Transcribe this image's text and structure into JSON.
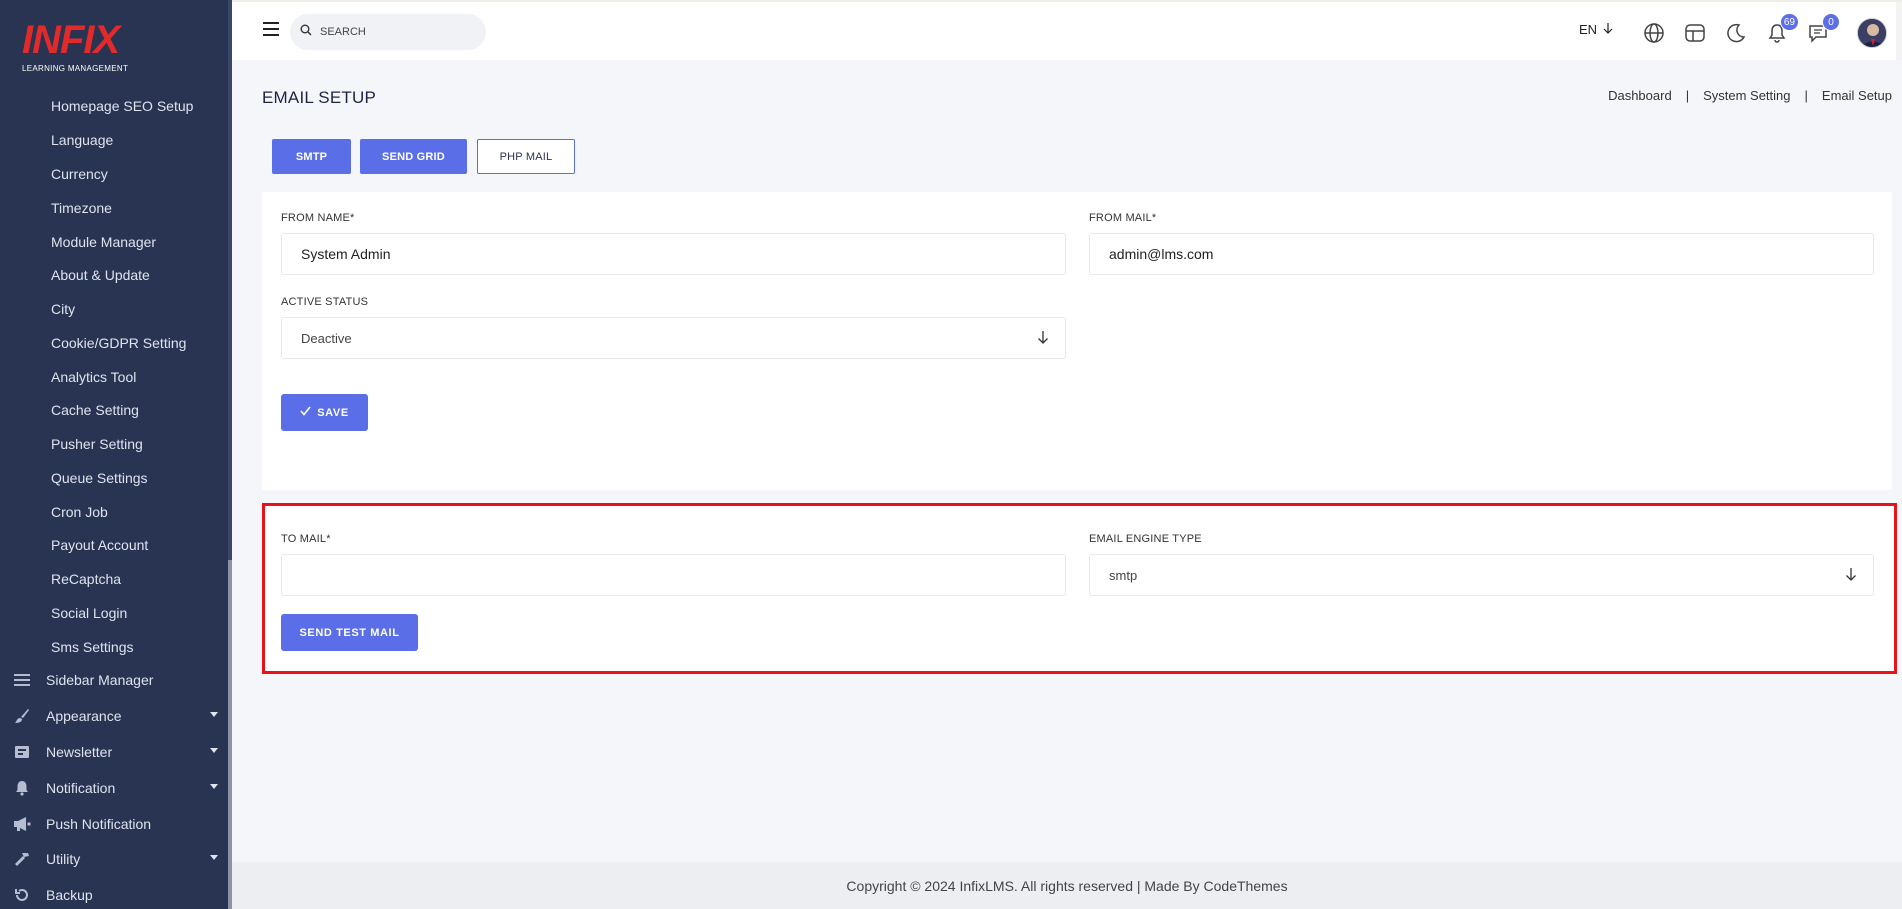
{
  "brand": {
    "name": "INFIX",
    "tagline": "LEARNING MANAGEMENT"
  },
  "sidebar": {
    "sub_items": [
      "Homepage SEO Setup",
      "Language",
      "Currency",
      "Timezone",
      "Module Manager",
      "About & Update",
      "City",
      "Cookie/GDPR Setting",
      "Analytics Tool",
      "Cache Setting",
      "Pusher Setting",
      "Queue Settings",
      "Cron Job",
      "Payout Account",
      "ReCaptcha",
      "Social Login",
      "Sms Settings"
    ],
    "main_items": [
      {
        "label": "Sidebar Manager",
        "icon": "list-icon"
      },
      {
        "label": "Appearance",
        "icon": "brush-icon"
      },
      {
        "label": "Newsletter",
        "icon": "newsletter-icon"
      },
      {
        "label": "Notification",
        "icon": "bell-icon"
      },
      {
        "label": "Push Notification",
        "icon": "megaphone-icon"
      },
      {
        "label": "Utility",
        "icon": "hammer-icon"
      },
      {
        "label": "Backup",
        "icon": "backup-icon"
      }
    ]
  },
  "topbar": {
    "search_placeholder": "SEARCH",
    "language": "EN",
    "notifications_count": "69",
    "messages_count": "0"
  },
  "page": {
    "title": "EMAIL SETUP",
    "breadcrumb": [
      "Dashboard",
      "System Setting",
      "Email Setup"
    ]
  },
  "tabs": {
    "smtp": "SMTP",
    "sendgrid": "SEND GRID",
    "phpmail": "PHP MAIL"
  },
  "form": {
    "from_name_label": "FROM NAME*",
    "from_name_value": "System Admin",
    "from_mail_label": "FROM MAIL*",
    "from_mail_value": "admin@lms.com",
    "active_status_label": "ACTIVE STATUS",
    "active_status_value": "Deactive",
    "save_label": "SAVE"
  },
  "test_mail": {
    "to_mail_label": "TO MAIL*",
    "to_mail_value": "",
    "engine_label": "EMAIL ENGINE TYPE",
    "engine_value": "smtp",
    "send_label": "SEND TEST MAIL"
  },
  "footer": {
    "text": "Copyright © 2024 InfixLMS. All rights reserved | Made By CodeThemes"
  },
  "colors": {
    "sidebar": "#283452",
    "accent": "#5a6ee8",
    "brand_red": "#e32a2a",
    "highlight_red": "#e8121b"
  }
}
